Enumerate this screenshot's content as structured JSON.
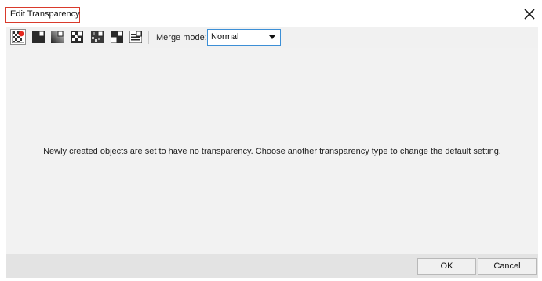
{
  "dialog": {
    "title": "Edit Transparency"
  },
  "toolbar": {
    "tools": [
      {
        "icon": "no-transparency-icon",
        "active": true
      },
      {
        "icon": "uniform-transparency-icon",
        "active": false
      },
      {
        "icon": "fountain-transparency-icon",
        "active": false
      },
      {
        "icon": "vector-pattern-transparency-icon",
        "active": false
      },
      {
        "icon": "bitmap-pattern-transparency-icon",
        "active": false
      },
      {
        "icon": "two-color-pattern-transparency-icon",
        "active": false
      },
      {
        "icon": "texture-transparency-icon",
        "active": false
      }
    ],
    "merge_mode_label": "Merge mode:",
    "merge_mode_value": "Normal"
  },
  "content": {
    "message": "Newly created objects are set to have no transparency. Choose another transparency type to change the default setting."
  },
  "footer": {
    "ok_label": "OK",
    "cancel_label": "Cancel"
  },
  "colors": {
    "title_highlight": "#d93a2b",
    "select_border": "#3c8fd6",
    "active_marker": "#e5271d"
  }
}
